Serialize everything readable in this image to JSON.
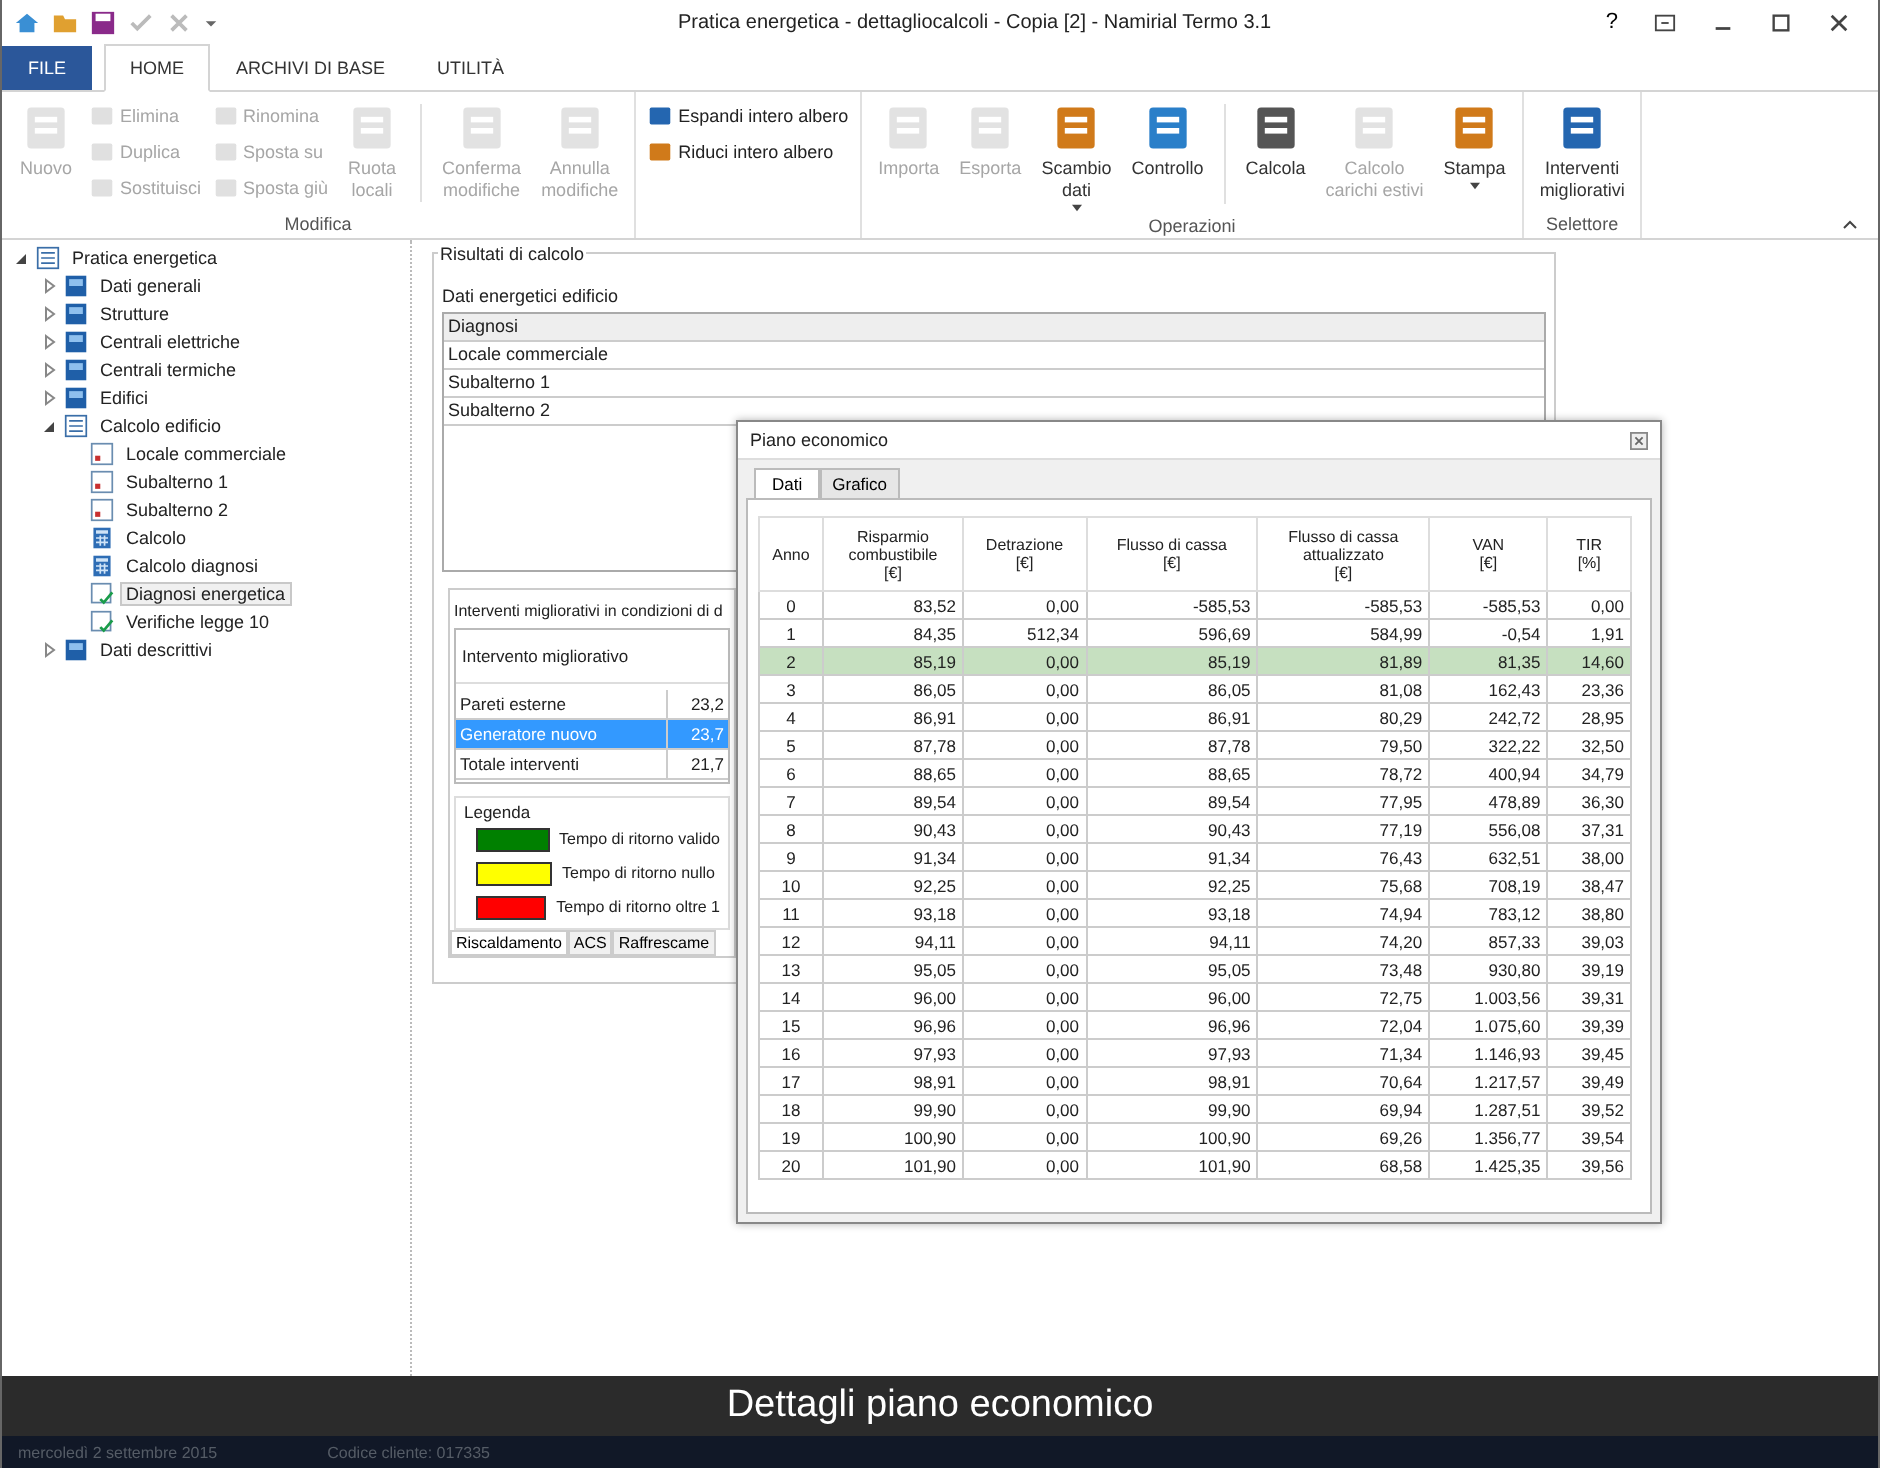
{
  "window": {
    "title": "Pratica energetica - dettagliocalcoli - Copia [2] - Namirial Termo 3.1",
    "controls": [
      "?"
    ]
  },
  "ribbon_tabs": [
    {
      "label": "FILE",
      "kind": "file",
      "selected": false
    },
    {
      "label": "HOME",
      "kind": "tab",
      "selected": true
    },
    {
      "label": "ARCHIVI DI BASE",
      "kind": "tab",
      "selected": false
    },
    {
      "label": "UTILITÀ",
      "kind": "tab",
      "selected": false
    }
  ],
  "ribbon": {
    "groups": [
      {
        "label": "Modifica",
        "items": [
          {
            "kind": "large",
            "label": "Nuovo",
            "disabled": true
          },
          {
            "kind": "stack",
            "items": [
              {
                "label": "Elimina",
                "disabled": true
              },
              {
                "label": "Duplica",
                "disabled": true
              },
              {
                "label": "Sostituisci",
                "disabled": true
              }
            ]
          },
          {
            "kind": "stack",
            "items": [
              {
                "label": "Rinomina",
                "disabled": true
              },
              {
                "label": "Sposta su",
                "disabled": true
              },
              {
                "label": "Sposta giù",
                "disabled": true
              }
            ]
          },
          {
            "kind": "large",
            "label": "Ruota\nlocali",
            "disabled": true
          },
          {
            "kind": "sep"
          },
          {
            "kind": "large",
            "label": "Conferma\nmodifiche",
            "disabled": true
          },
          {
            "kind": "large",
            "label": "Annulla\nmodifiche",
            "disabled": true
          }
        ]
      },
      {
        "items": [
          {
            "kind": "stack",
            "items": [
              {
                "label": "Espandi intero albero",
                "disabled": false
              },
              {
                "label": "Riduci intero albero",
                "disabled": false
              }
            ]
          }
        ]
      },
      {
        "label": "Operazioni",
        "items": [
          {
            "kind": "large",
            "label": "Importa",
            "disabled": true
          },
          {
            "kind": "large",
            "label": "Esporta",
            "disabled": true
          },
          {
            "kind": "large",
            "label": "Scambio\ndati",
            "disabled": false,
            "dropdown": true
          },
          {
            "kind": "large",
            "label": "Controllo",
            "disabled": false
          },
          {
            "kind": "sep"
          },
          {
            "kind": "large",
            "label": "Calcola",
            "disabled": false
          },
          {
            "kind": "large",
            "label": "Calcolo\ncarichi estivi",
            "disabled": true
          },
          {
            "kind": "large",
            "label": "Stampa",
            "disabled": false,
            "dropdown": true
          }
        ]
      },
      {
        "label": "Selettore",
        "items": [
          {
            "kind": "large",
            "label": "Interventi\nmigliorativi",
            "disabled": false
          }
        ]
      }
    ]
  },
  "tree": [
    {
      "label": "Pratica energetica",
      "kind": "list",
      "expanded": true,
      "selected": false,
      "children": [
        {
          "label": "Dati generali",
          "kind": "block",
          "expanded": false,
          "selected": false
        },
        {
          "label": "Strutture",
          "kind": "block",
          "expanded": false,
          "selected": false
        },
        {
          "label": "Centrali elettriche",
          "kind": "block",
          "expanded": false,
          "selected": false
        },
        {
          "label": "Centrali termiche",
          "kind": "block",
          "expanded": false,
          "selected": false
        },
        {
          "label": "Edifici",
          "kind": "block",
          "expanded": false,
          "selected": false
        },
        {
          "label": "Calcolo edificio",
          "kind": "list",
          "expanded": true,
          "selected": false,
          "children": [
            {
              "label": "Locale commerciale",
              "kind": "doc",
              "selected": false
            },
            {
              "label": "Subalterno 1",
              "kind": "doc",
              "selected": false
            },
            {
              "label": "Subalterno 2",
              "kind": "doc",
              "selected": false
            },
            {
              "label": "Calcolo",
              "kind": "calc",
              "selected": false
            },
            {
              "label": "Calcolo diagnosi",
              "kind": "calc",
              "selected": false
            },
            {
              "label": "Diagnosi energetica",
              "kind": "check",
              "selected": true
            },
            {
              "label": "Verifiche legge 10",
              "kind": "check",
              "selected": false
            }
          ]
        },
        {
          "label": "Dati descrittivi",
          "kind": "block",
          "expanded": false,
          "selected": false
        }
      ]
    }
  ],
  "results": {
    "title": "Risultati di calcolo",
    "subtitle": "Dati energetici edificio",
    "list": [
      {
        "label": "Diagnosi",
        "selected": true
      },
      {
        "label": "Locale commerciale",
        "selected": false
      },
      {
        "label": "Subalterno 1",
        "selected": false
      },
      {
        "label": "Subalterno 2",
        "selected": false
      }
    ],
    "improvements": {
      "title": "Interventi migliorativi in condizioni di d",
      "column": "Intervento migliorativo",
      "rows": [
        {
          "name": "Pareti esterne",
          "value": "23,2",
          "selected": false
        },
        {
          "name": "Generatore nuovo",
          "value": "23,7",
          "selected": true
        },
        {
          "name": "Totale interventi",
          "value": "21,7",
          "selected": false
        }
      ],
      "legend_title": "Legenda",
      "legend": [
        {
          "label": "Tempo di ritorno valido",
          "color": "#008000"
        },
        {
          "label": "Tempo di ritorno nullo",
          "color": "#ffff00"
        },
        {
          "label": "Tempo di ritorno oltre 1",
          "color": "#ff0000"
        }
      ],
      "tabs": [
        {
          "label": "Riscaldamento",
          "selected": true
        },
        {
          "label": "ACS",
          "selected": false
        },
        {
          "label": "Raffrescame",
          "selected": false
        }
      ]
    }
  },
  "dialog": {
    "title": "Piano economico",
    "tabs": [
      {
        "label": "Dati",
        "selected": true
      },
      {
        "label": "Grafico",
        "selected": false
      }
    ],
    "columns": [
      "Anno",
      "Risparmio\ncombustibile\n[€]",
      "Detrazione\n[€]",
      "Flusso di cassa\n[€]",
      "Flusso di cassa\nattualizzato\n[€]",
      "VAN\n[€]",
      "TIR\n[%]"
    ],
    "rows": [
      {
        "cells": [
          "0",
          "83,52",
          "0,00",
          "-585,53",
          "-585,53",
          "-585,53",
          "0,00"
        ],
        "selected": false
      },
      {
        "cells": [
          "1",
          "84,35",
          "512,34",
          "596,69",
          "584,99",
          "-0,54",
          "1,91"
        ],
        "selected": false
      },
      {
        "cells": [
          "2",
          "85,19",
          "0,00",
          "85,19",
          "81,89",
          "81,35",
          "14,60"
        ],
        "selected": true
      },
      {
        "cells": [
          "3",
          "86,05",
          "0,00",
          "86,05",
          "81,08",
          "162,43",
          "23,36"
        ],
        "selected": false
      },
      {
        "cells": [
          "4",
          "86,91",
          "0,00",
          "86,91",
          "80,29",
          "242,72",
          "28,95"
        ],
        "selected": false
      },
      {
        "cells": [
          "5",
          "87,78",
          "0,00",
          "87,78",
          "79,50",
          "322,22",
          "32,50"
        ],
        "selected": false
      },
      {
        "cells": [
          "6",
          "88,65",
          "0,00",
          "88,65",
          "78,72",
          "400,94",
          "34,79"
        ],
        "selected": false
      },
      {
        "cells": [
          "7",
          "89,54",
          "0,00",
          "89,54",
          "77,95",
          "478,89",
          "36,30"
        ],
        "selected": false
      },
      {
        "cells": [
          "8",
          "90,43",
          "0,00",
          "90,43",
          "77,19",
          "556,08",
          "37,31"
        ],
        "selected": false
      },
      {
        "cells": [
          "9",
          "91,34",
          "0,00",
          "91,34",
          "76,43",
          "632,51",
          "38,00"
        ],
        "selected": false
      },
      {
        "cells": [
          "10",
          "92,25",
          "0,00",
          "92,25",
          "75,68",
          "708,19",
          "38,47"
        ],
        "selected": false
      },
      {
        "cells": [
          "11",
          "93,18",
          "0,00",
          "93,18",
          "74,94",
          "783,12",
          "38,80"
        ],
        "selected": false
      },
      {
        "cells": [
          "12",
          "94,11",
          "0,00",
          "94,11",
          "74,20",
          "857,33",
          "39,03"
        ],
        "selected": false
      },
      {
        "cells": [
          "13",
          "95,05",
          "0,00",
          "95,05",
          "73,48",
          "930,80",
          "39,19"
        ],
        "selected": false
      },
      {
        "cells": [
          "14",
          "96,00",
          "0,00",
          "96,00",
          "72,75",
          "1.003,56",
          "39,31"
        ],
        "selected": false
      },
      {
        "cells": [
          "15",
          "96,96",
          "0,00",
          "96,96",
          "72,04",
          "1.075,60",
          "39,39"
        ],
        "selected": false
      },
      {
        "cells": [
          "16",
          "97,93",
          "0,00",
          "97,93",
          "71,34",
          "1.146,93",
          "39,45"
        ],
        "selected": false
      },
      {
        "cells": [
          "17",
          "98,91",
          "0,00",
          "98,91",
          "70,64",
          "1.217,57",
          "39,49"
        ],
        "selected": false
      },
      {
        "cells": [
          "18",
          "99,90",
          "0,00",
          "99,90",
          "69,94",
          "1.287,51",
          "39,52"
        ],
        "selected": false
      },
      {
        "cells": [
          "19",
          "100,90",
          "0,00",
          "100,90",
          "69,26",
          "1.356,77",
          "39,54"
        ],
        "selected": false
      },
      {
        "cells": [
          "20",
          "101,90",
          "0,00",
          "101,90",
          "68,58",
          "1.425,35",
          "39,56"
        ],
        "selected": false
      }
    ]
  },
  "caption": "Dettagli piano economico",
  "status_bar": [
    "mercoledì 2 settembre 2015",
    "Codice cliente: 017335"
  ]
}
